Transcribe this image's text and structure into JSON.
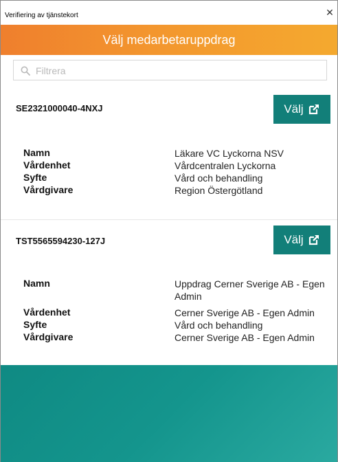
{
  "window": {
    "title": "Verifiering av tjänstekort"
  },
  "header": {
    "title": "Välj medarbetaruppdrag"
  },
  "filter": {
    "placeholder": "Filtrera",
    "value": ""
  },
  "assignments": [
    {
      "id": "SE2321000040-4NXJ",
      "button_label": "Välj",
      "fields": [
        {
          "label": "Namn",
          "value": "Läkare VC Lyckorna NSV"
        },
        {
          "label": "Vårdenhet",
          "value": "Vårdcentralen Lyckorna"
        },
        {
          "label": "Syfte",
          "value": "Vård och behandling"
        },
        {
          "label": "Vårdgivare",
          "value": "Region Östergötland"
        }
      ]
    },
    {
      "id": "TST5565594230-127J",
      "button_label": "Välj",
      "fields": [
        {
          "label": "Namn",
          "value": "Uppdrag Cerner Sverige AB - Egen Admin"
        },
        {
          "label": "Vårdenhet",
          "value": "Cerner Sverige AB - Egen Admin"
        },
        {
          "label": "Syfte",
          "value": "Vård och behandling"
        },
        {
          "label": "Vårdgivare",
          "value": "Cerner Sverige AB - Egen Admin"
        }
      ]
    }
  ],
  "colors": {
    "header_gradient_start": "#ef7f2d",
    "header_gradient_end": "#f4a92f",
    "button": "#127f79",
    "footer": "#14958d"
  },
  "icons": {
    "close": "close-icon",
    "search": "search-icon",
    "external": "external-link-icon"
  }
}
